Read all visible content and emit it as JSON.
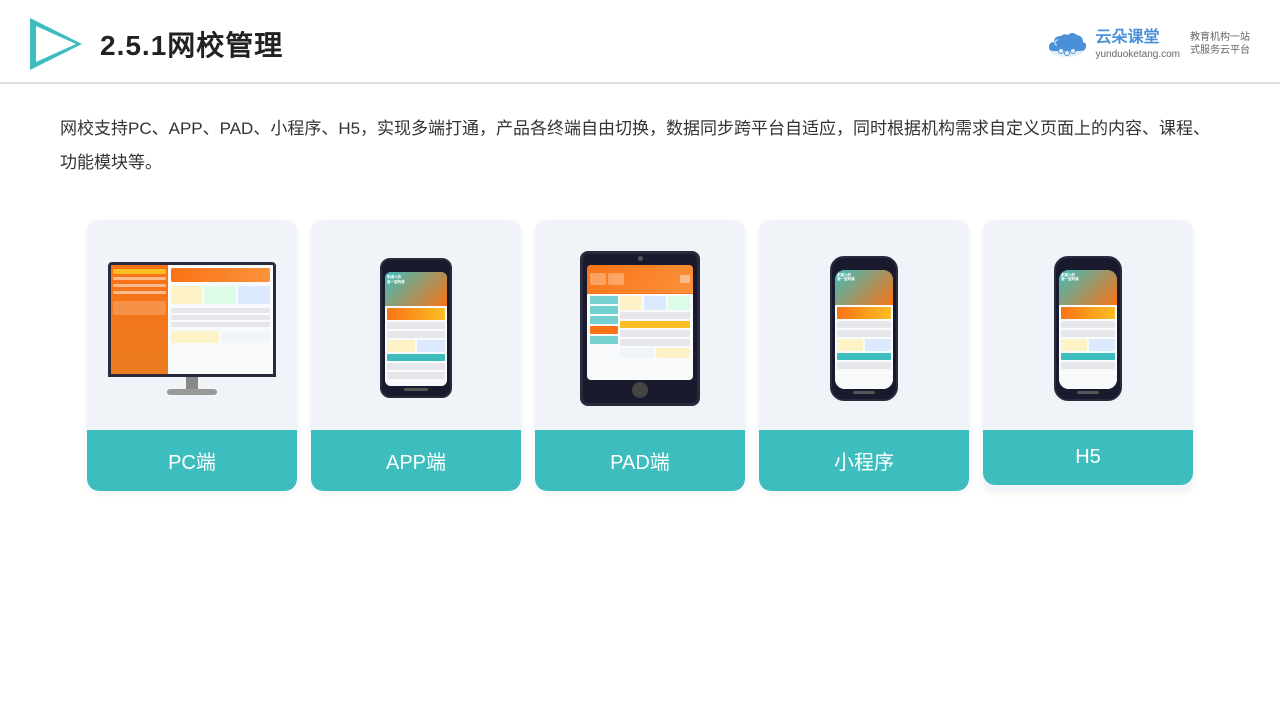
{
  "header": {
    "title": "2.5.1网校管理",
    "brand_name": "云朵课堂",
    "brand_domain": "yunduoketang.com",
    "brand_tagline": "教育机构一站\n式服务云平台"
  },
  "description": "网校支持PC、APP、PAD、小程序、H5，实现多端打通，产品各终端自由切换，数据同步跨平台自适应，同时根据机构需求自定义页面上的内容、课程、功能模块等。",
  "cards": [
    {
      "id": "pc",
      "label": "PC端",
      "device": "monitor"
    },
    {
      "id": "app",
      "label": "APP端",
      "device": "phone"
    },
    {
      "id": "pad",
      "label": "PAD端",
      "device": "tablet"
    },
    {
      "id": "miniprogram",
      "label": "小程序",
      "device": "thin-phone"
    },
    {
      "id": "h5",
      "label": "H5",
      "device": "thin-phone2"
    }
  ],
  "colors": {
    "teal": "#3dbdbd",
    "accent": "#f97316",
    "brand_blue": "#4a90d9"
  }
}
